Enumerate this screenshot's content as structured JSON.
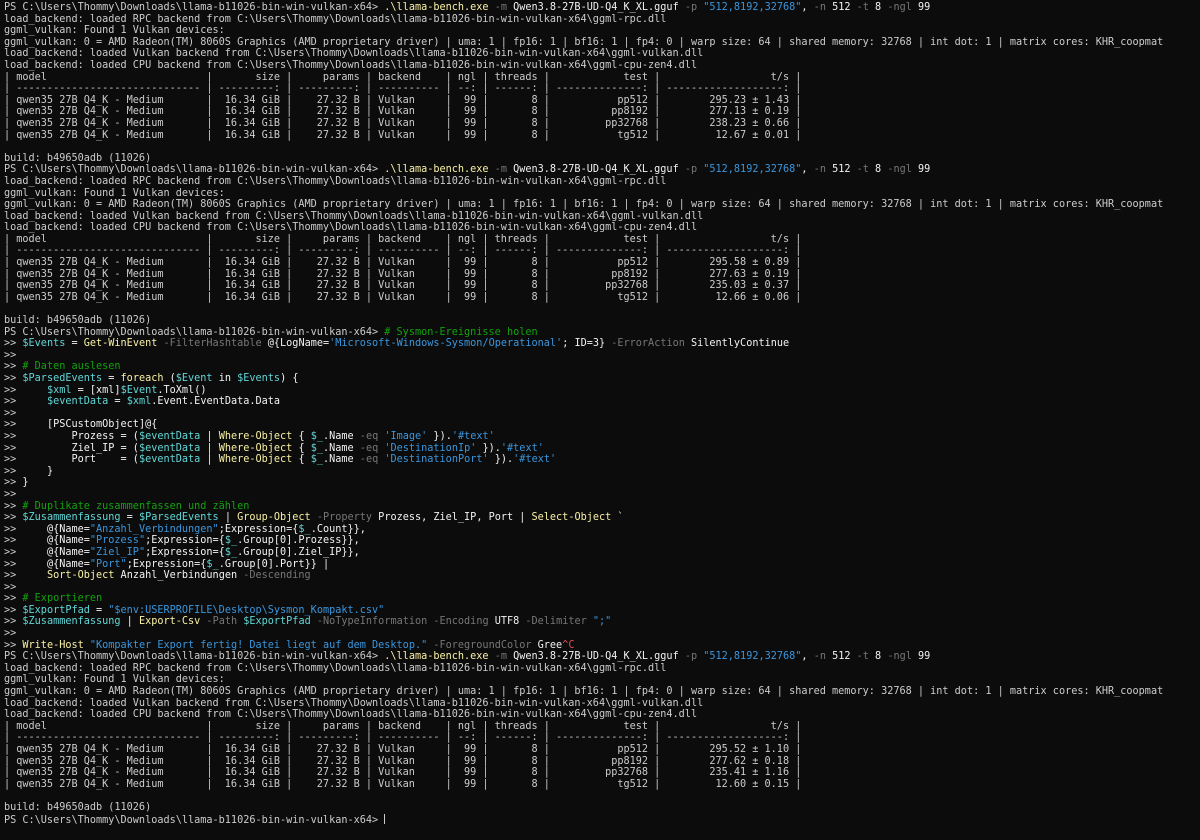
{
  "terminal": {
    "prompt": "PS C:\\Users\\Thommy\\Downloads\\llama-b11026-bin-win-vulkan-x64> ",
    "cont": ">> ",
    "runs": [
      {
        "cmd": {
          "exe": ".\\llama-bench.exe",
          "args": [
            {
              "type": "param",
              "text": " -m"
            },
            {
              "type": "plain",
              "text": " Qwen3.8-27B-UD-Q4_K_XL.gguf"
            },
            {
              "type": "param",
              "text": " -p"
            },
            {
              "type": "str",
              "text": " \"512,8192,32768\""
            },
            {
              "type": "plain",
              "text": ", "
            },
            {
              "type": "param",
              "text": "-n"
            },
            {
              "type": "plain",
              "text": " 512"
            },
            {
              "type": "param",
              "text": " -t"
            },
            {
              "type": "plain",
              "text": " 8"
            },
            {
              "type": "param",
              "text": " -ngl"
            },
            {
              "type": "plain",
              "text": " 99"
            }
          ]
        },
        "log": [
          "load_backend: loaded RPC backend from C:\\Users\\Thommy\\Downloads\\llama-b11026-bin-win-vulkan-x64\\ggml-rpc.dll",
          "ggml_vulkan: Found 1 Vulkan devices:",
          "ggml_vulkan: 0 = AMD Radeon(TM) 8060S Graphics (AMD proprietary driver) | uma: 1 | fp16: 1 | bf16: 1 | fp4: 0 | warp size: 64 | shared memory: 32768 | int dot: 1 | matrix cores: KHR_coopmat",
          "load_backend: loaded Vulkan backend from C:\\Users\\Thommy\\Downloads\\llama-b11026-bin-win-vulkan-x64\\ggml-vulkan.dll",
          "load_backend: loaded CPU backend from C:\\Users\\Thommy\\Downloads\\llama-b11026-bin-win-vulkan-x64\\ggml-cpu-zen4.dll"
        ],
        "table": [
          "| model                          |       size |     params | backend    | ngl | threads |            test |                  t/s |",
          "| ------------------------------ | ---------: | ---------: | ---------- | --: | ------: | --------------: | -------------------: |",
          "| qwen35 27B Q4_K - Medium       |  16.34 GiB |    27.32 B | Vulkan     |  99 |       8 |           pp512 |        295.23 ± 1.43 |",
          "| qwen35 27B Q4_K - Medium       |  16.34 GiB |    27.32 B | Vulkan     |  99 |       8 |          pp8192 |        277.13 ± 0.19 |",
          "| qwen35 27B Q4_K - Medium       |  16.34 GiB |    27.32 B | Vulkan     |  99 |       8 |         pp32768 |        238.23 ± 0.66 |",
          "| qwen35 27B Q4_K - Medium       |  16.34 GiB |    27.32 B | Vulkan     |  99 |       8 |           tg512 |         12.67 ± 0.01 |"
        ],
        "build": "build: b49650adb (11026)"
      },
      {
        "cmd": {
          "exe": ".\\llama-bench.exe",
          "args": [
            {
              "type": "param",
              "text": " -m"
            },
            {
              "type": "plain",
              "text": " Qwen3.8-27B-UD-Q4_K_XL.gguf"
            },
            {
              "type": "param",
              "text": " -p"
            },
            {
              "type": "str",
              "text": " \"512,8192,32768\""
            },
            {
              "type": "plain",
              "text": ", "
            },
            {
              "type": "param",
              "text": "-n"
            },
            {
              "type": "plain",
              "text": " 512"
            },
            {
              "type": "param",
              "text": " -t"
            },
            {
              "type": "plain",
              "text": " 8"
            },
            {
              "type": "param",
              "text": " -ngl"
            },
            {
              "type": "plain",
              "text": " 99"
            }
          ]
        },
        "log": [
          "load_backend: loaded RPC backend from C:\\Users\\Thommy\\Downloads\\llama-b11026-bin-win-vulkan-x64\\ggml-rpc.dll",
          "ggml_vulkan: Found 1 Vulkan devices:",
          "ggml_vulkan: 0 = AMD Radeon(TM) 8060S Graphics (AMD proprietary driver) | uma: 1 | fp16: 1 | bf16: 1 | fp4: 0 | warp size: 64 | shared memory: 32768 | int dot: 1 | matrix cores: KHR_coopmat",
          "load_backend: loaded Vulkan backend from C:\\Users\\Thommy\\Downloads\\llama-b11026-bin-win-vulkan-x64\\ggml-vulkan.dll",
          "load_backend: loaded CPU backend from C:\\Users\\Thommy\\Downloads\\llama-b11026-bin-win-vulkan-x64\\ggml-cpu-zen4.dll"
        ],
        "table": [
          "| model                          |       size |     params | backend    | ngl | threads |            test |                  t/s |",
          "| ------------------------------ | ---------: | ---------: | ---------- | --: | ------: | --------------: | -------------------: |",
          "| qwen35 27B Q4_K - Medium       |  16.34 GiB |    27.32 B | Vulkan     |  99 |       8 |           pp512 |        295.58 ± 0.89 |",
          "| qwen35 27B Q4_K - Medium       |  16.34 GiB |    27.32 B | Vulkan     |  99 |       8 |          pp8192 |        277.63 ± 0.19 |",
          "| qwen35 27B Q4_K - Medium       |  16.34 GiB |    27.32 B | Vulkan     |  99 |       8 |         pp32768 |        235.03 ± 0.37 |",
          "| qwen35 27B Q4_K - Medium       |  16.34 GiB |    27.32 B | Vulkan     |  99 |       8 |           tg512 |         12.66 ± 0.06 |"
        ],
        "build": "build: b49650adb (11026)"
      }
    ],
    "script": {
      "first": [
        {
          "t": "c",
          "v": "# Sysmon-Ereignisse holen"
        }
      ],
      "lines": [
        [
          {
            "t": "v",
            "v": "$Events"
          },
          {
            "t": "w",
            "v": " = "
          },
          {
            "t": "y",
            "v": "Get-WinEvent"
          },
          {
            "t": "g",
            "v": " -FilterHashtable"
          },
          {
            "t": "w",
            "v": " @{LogName="
          },
          {
            "t": "s",
            "v": "'Microsoft-Windows-Sysmon/Operational'"
          },
          {
            "t": "w",
            "v": "; ID=3}"
          },
          {
            "t": "g",
            "v": " -ErrorAction"
          },
          {
            "t": "w",
            "v": " SilentlyContinue"
          }
        ],
        [],
        [
          {
            "t": "c",
            "v": "# Daten auslesen"
          }
        ],
        [
          {
            "t": "v",
            "v": "$ParsedEvents"
          },
          {
            "t": "w",
            "v": " = "
          },
          {
            "t": "y",
            "v": "foreach"
          },
          {
            "t": "w",
            "v": " ("
          },
          {
            "t": "v",
            "v": "$Event"
          },
          {
            "t": "w",
            "v": " in "
          },
          {
            "t": "v",
            "v": "$Events"
          },
          {
            "t": "w",
            "v": ") {"
          }
        ],
        [
          {
            "t": "w",
            "v": "    "
          },
          {
            "t": "v",
            "v": "$xml"
          },
          {
            "t": "w",
            "v": " = [xml]"
          },
          {
            "t": "v",
            "v": "$Event"
          },
          {
            "t": "w",
            "v": ".ToXml()"
          }
        ],
        [
          {
            "t": "w",
            "v": "    "
          },
          {
            "t": "v",
            "v": "$eventData"
          },
          {
            "t": "w",
            "v": " = "
          },
          {
            "t": "v",
            "v": "$xml"
          },
          {
            "t": "w",
            "v": ".Event.EventData.Data"
          }
        ],
        [],
        [
          {
            "t": "w",
            "v": "    [PSCustomObject]@{"
          }
        ],
        [
          {
            "t": "w",
            "v": "        Prozess = ("
          },
          {
            "t": "v",
            "v": "$eventData"
          },
          {
            "t": "w",
            "v": " | "
          },
          {
            "t": "y",
            "v": "Where-Object"
          },
          {
            "t": "w",
            "v": " { "
          },
          {
            "t": "v",
            "v": "$_"
          },
          {
            "t": "w",
            "v": ".Name"
          },
          {
            "t": "g",
            "v": " -eq"
          },
          {
            "t": "s",
            "v": " 'Image'"
          },
          {
            "t": "w",
            "v": " })."
          },
          {
            "t": "s",
            "v": "'#text'"
          }
        ],
        [
          {
            "t": "w",
            "v": "        Ziel_IP = ("
          },
          {
            "t": "v",
            "v": "$eventData"
          },
          {
            "t": "w",
            "v": " | "
          },
          {
            "t": "y",
            "v": "Where-Object"
          },
          {
            "t": "w",
            "v": " { "
          },
          {
            "t": "v",
            "v": "$_"
          },
          {
            "t": "w",
            "v": ".Name"
          },
          {
            "t": "g",
            "v": " -eq"
          },
          {
            "t": "s",
            "v": " 'DestinationIp'"
          },
          {
            "t": "w",
            "v": " })."
          },
          {
            "t": "s",
            "v": "'#text'"
          }
        ],
        [
          {
            "t": "w",
            "v": "        Port    = ("
          },
          {
            "t": "v",
            "v": "$eventData"
          },
          {
            "t": "w",
            "v": " | "
          },
          {
            "t": "y",
            "v": "Where-Object"
          },
          {
            "t": "w",
            "v": " { "
          },
          {
            "t": "v",
            "v": "$_"
          },
          {
            "t": "w",
            "v": ".Name"
          },
          {
            "t": "g",
            "v": " -eq"
          },
          {
            "t": "s",
            "v": " 'DestinationPort'"
          },
          {
            "t": "w",
            "v": " })."
          },
          {
            "t": "s",
            "v": "'#text'"
          }
        ],
        [
          {
            "t": "w",
            "v": "    }"
          }
        ],
        [
          {
            "t": "w",
            "v": "}"
          }
        ],
        [],
        [
          {
            "t": "c",
            "v": "# Duplikate zusammenfassen und zählen"
          }
        ],
        [
          {
            "t": "v",
            "v": "$Zusammenfassung"
          },
          {
            "t": "w",
            "v": " = "
          },
          {
            "t": "v",
            "v": "$ParsedEvents"
          },
          {
            "t": "w",
            "v": " | "
          },
          {
            "t": "y",
            "v": "Group-Object"
          },
          {
            "t": "g",
            "v": " -Property"
          },
          {
            "t": "w",
            "v": " Prozess, Ziel_IP, Port | "
          },
          {
            "t": "y",
            "v": "Select-Object"
          },
          {
            "t": "w",
            "v": " `"
          }
        ],
        [
          {
            "t": "w",
            "v": "    @{Name="
          },
          {
            "t": "s",
            "v": "\"Anzahl_Verbindungen\""
          },
          {
            "t": "w",
            "v": ";Expression={"
          },
          {
            "t": "v",
            "v": "$_"
          },
          {
            "t": "w",
            "v": ".Count}},"
          }
        ],
        [
          {
            "t": "w",
            "v": "    @{Name="
          },
          {
            "t": "s",
            "v": "\"Prozess\""
          },
          {
            "t": "w",
            "v": ";Expression={"
          },
          {
            "t": "v",
            "v": "$_"
          },
          {
            "t": "w",
            "v": ".Group[0].Prozess}},"
          }
        ],
        [
          {
            "t": "w",
            "v": "    @{Name="
          },
          {
            "t": "s",
            "v": "\"Ziel_IP\""
          },
          {
            "t": "w",
            "v": ";Expression={"
          },
          {
            "t": "v",
            "v": "$_"
          },
          {
            "t": "w",
            "v": ".Group[0].Ziel_IP}},"
          }
        ],
        [
          {
            "t": "w",
            "v": "    @{Name="
          },
          {
            "t": "s",
            "v": "\"Port\""
          },
          {
            "t": "w",
            "v": ";Expression={"
          },
          {
            "t": "v",
            "v": "$_"
          },
          {
            "t": "w",
            "v": ".Group[0].Port}} |"
          }
        ],
        [
          {
            "t": "w",
            "v": "    "
          },
          {
            "t": "y",
            "v": "Sort-Object"
          },
          {
            "t": "w",
            "v": " Anzahl_Verbindungen"
          },
          {
            "t": "g",
            "v": " -Descending"
          }
        ],
        [],
        [
          {
            "t": "c",
            "v": "# Exportieren"
          }
        ],
        [
          {
            "t": "v",
            "v": "$ExportPfad"
          },
          {
            "t": "w",
            "v": " = "
          },
          {
            "t": "s",
            "v": "\"$env:USERPROFILE\\Desktop\\Sysmon_Kompakt.csv\""
          }
        ],
        [
          {
            "t": "v",
            "v": "$Zusammenfassung"
          },
          {
            "t": "w",
            "v": " | "
          },
          {
            "t": "y",
            "v": "Export-Csv"
          },
          {
            "t": "g",
            "v": " -Path"
          },
          {
            "t": "v",
            "v": " $ExportPfad"
          },
          {
            "t": "g",
            "v": " -NoTypeInformation -Encoding"
          },
          {
            "t": "w",
            "v": " UTF8"
          },
          {
            "t": "g",
            "v": " -Delimiter"
          },
          {
            "t": "s",
            "v": " \";\""
          }
        ],
        [],
        [
          {
            "t": "y",
            "v": "Write-Host"
          },
          {
            "t": "s",
            "v": " \"Kompakter Export fertig! Datei liegt auf dem Desktop.\""
          },
          {
            "t": "g",
            "v": " -ForegroundColor"
          },
          {
            "t": "w",
            "v": " Gree"
          },
          {
            "t": "r",
            "v": "^C"
          }
        ]
      ]
    },
    "run3": {
      "log": [
        "load_backend: loaded RPC backend from C:\\Users\\Thommy\\Downloads\\llama-b11026-bin-win-vulkan-x64\\ggml-rpc.dll",
        "ggml_vulkan: Found 1 Vulkan devices:",
        "ggml_vulkan: 0 = AMD Radeon(TM) 8060S Graphics (AMD proprietary driver) | uma: 1 | fp16: 1 | bf16: 1 | fp4: 0 | warp size: 64 | shared memory: 32768 | int dot: 1 | matrix cores: KHR_coopmat",
        "load_backend: loaded Vulkan backend from C:\\Users\\Thommy\\Downloads\\llama-b11026-bin-win-vulkan-x64\\ggml-vulkan.dll",
        "load_backend: loaded CPU backend from C:\\Users\\Thommy\\Downloads\\llama-b11026-bin-win-vulkan-x64\\ggml-cpu-zen4.dll"
      ],
      "table": [
        "| model                          |       size |     params | backend    | ngl | threads |            test |                  t/s |",
        "| ------------------------------ | ---------: | ---------: | ---------- | --: | ------: | --------------: | -------------------: |",
        "| qwen35 27B Q4_K - Medium       |  16.34 GiB |    27.32 B | Vulkan     |  99 |       8 |           pp512 |        295.52 ± 1.10 |",
        "| qwen35 27B Q4_K - Medium       |  16.34 GiB |    27.32 B | Vulkan     |  99 |       8 |          pp8192 |        277.62 ± 0.18 |",
        "| qwen35 27B Q4_K - Medium       |  16.34 GiB |    27.32 B | Vulkan     |  99 |       8 |         pp32768 |        235.41 ± 1.16 |",
        "| qwen35 27B Q4_K - Medium       |  16.34 GiB |    27.32 B | Vulkan     |  99 |       8 |           tg512 |         12.60 ± 0.15 |"
      ],
      "build": "build: b49650adb (11026)"
    }
  },
  "colors": {
    "background": "#0c0c0c",
    "text": "#cccccc",
    "command": "#f9f1a5",
    "parameter": "#767676",
    "string": "#3a96dd",
    "variable": "#61d6d6",
    "comment": "#13a10e"
  }
}
